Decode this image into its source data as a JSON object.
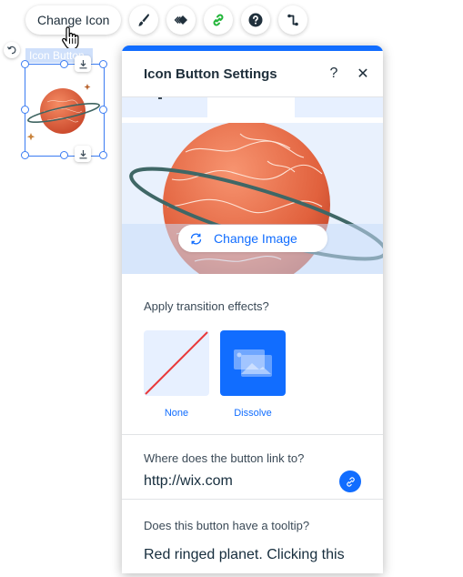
{
  "toolbar": {
    "change_icon_label": "Change Icon",
    "buttons": [
      {
        "name": "design",
        "icon": "paintbrush-icon"
      },
      {
        "name": "animation",
        "icon": "animation-diamond-icon"
      },
      {
        "name": "link",
        "icon": "link-icon",
        "color": "#25b63c"
      },
      {
        "name": "help",
        "icon": "question-circle-icon"
      },
      {
        "name": "connect",
        "icon": "connect-path-icon"
      }
    ]
  },
  "canvas": {
    "element_label": "Icon Button",
    "selection_color": "#3b7cf2"
  },
  "panel": {
    "title": "Icon Button Settings",
    "help_label": "?",
    "close_label": "✕",
    "accent": "#116dff",
    "change_image_label": "Change Image",
    "transition": {
      "label": "Apply transition effects?",
      "options": [
        {
          "label": "None",
          "selected": false
        },
        {
          "label": "Dissolve",
          "selected": true
        }
      ]
    },
    "link": {
      "label": "Where does the button link to?",
      "value": "http://wix.com"
    },
    "tooltip": {
      "label": "Does this button have a tooltip?",
      "value": "Red ringed planet. Clicking this"
    }
  }
}
